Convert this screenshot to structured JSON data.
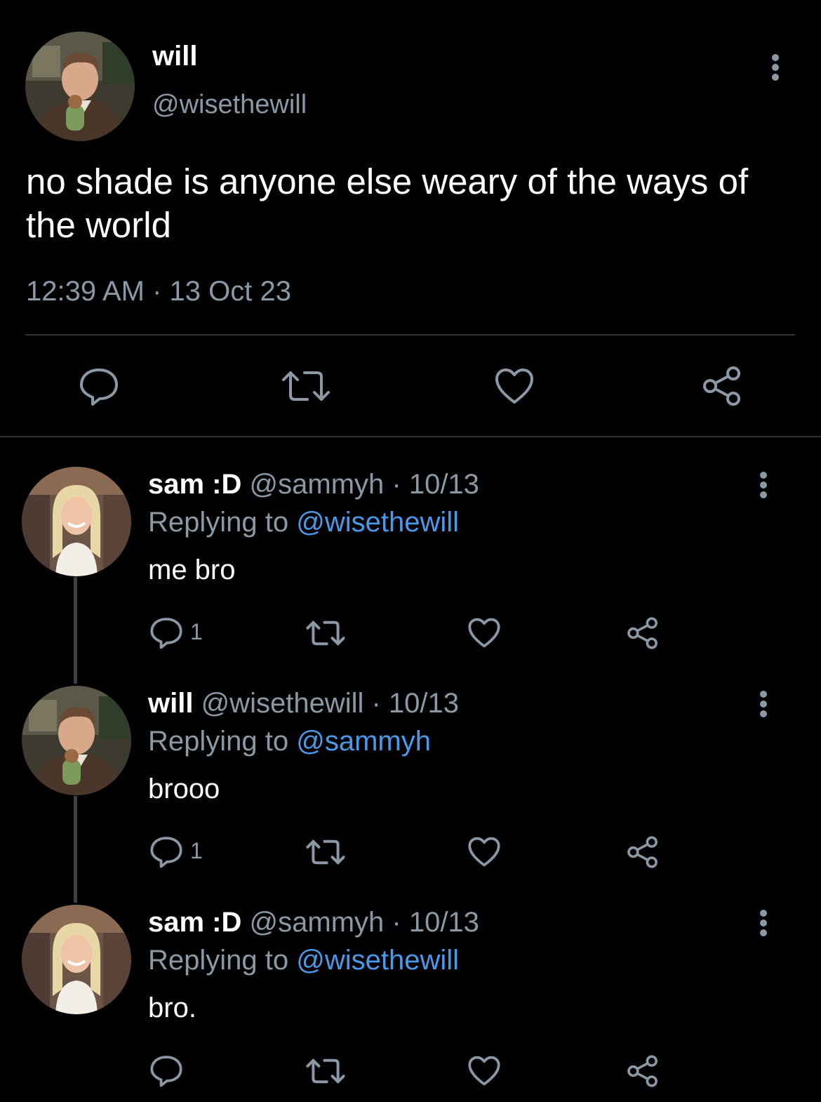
{
  "main_tweet": {
    "author_name": "will",
    "author_handle": "@wisethewill",
    "text": "no shade is anyone else weary of the ways of the world",
    "timestamp": "12:39 AM · 13 Oct 23",
    "actions": [
      "reply-icon",
      "retweet-icon",
      "like-icon",
      "share-icon"
    ]
  },
  "replies": [
    {
      "author_name": "sam :D",
      "author_handle": "@sammyh",
      "date": "· 10/13",
      "replying_prefix": "Replying to",
      "replying_to": "@wisethewill",
      "text": "me bro",
      "reply_count": "1"
    },
    {
      "author_name": "will",
      "author_handle": "@wisethewill",
      "date": "· 10/13",
      "replying_prefix": "Replying to",
      "replying_to": "@sammyh",
      "text": "brooo",
      "reply_count": "1"
    },
    {
      "author_name": "sam :D",
      "author_handle": "@sammyh",
      "date": "· 10/13",
      "replying_prefix": "Replying to",
      "replying_to": "@wisethewill",
      "text": "bro.",
      "reply_count": ""
    }
  ],
  "colors": {
    "background": "#000000",
    "text": "#e7e9ea",
    "muted": "#8b98a5",
    "link": "#4a99e9",
    "divider": "#2f3336"
  }
}
